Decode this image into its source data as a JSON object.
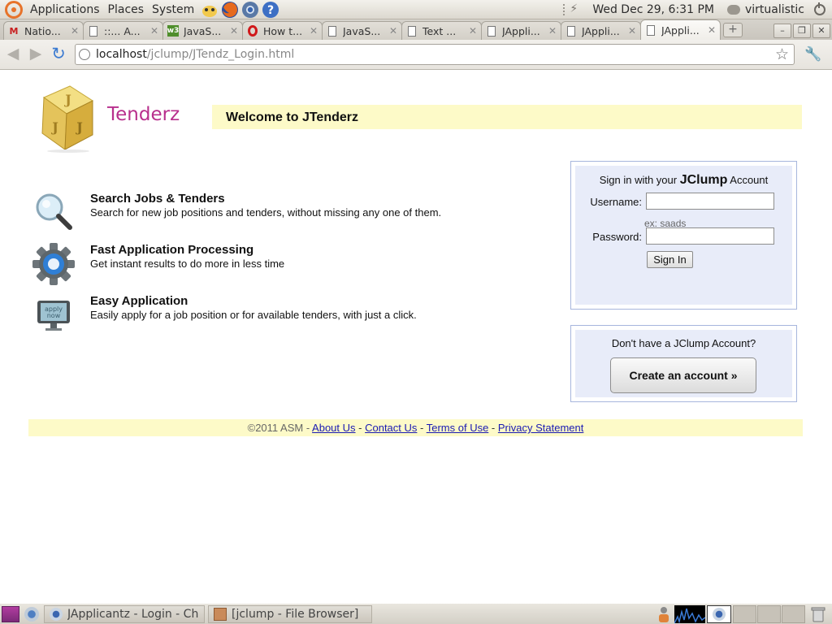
{
  "top_panel": {
    "menus": [
      "Applications",
      "Places",
      "System"
    ],
    "clock": "Wed Dec 29,  6:31 PM",
    "user": "virtualistic"
  },
  "tabs": [
    {
      "title": "Natio...",
      "favicon": "gmail-icon"
    },
    {
      "title": "::... A...",
      "favicon": "page-icon"
    },
    {
      "title": "JavaS...",
      "favicon": "w3schools-icon"
    },
    {
      "title": "How t...",
      "favicon": "opera-icon"
    },
    {
      "title": "JavaS...",
      "favicon": "page-icon"
    },
    {
      "title": "Text ...",
      "favicon": "page-icon"
    },
    {
      "title": "JAppli...",
      "favicon": "page-icon"
    },
    {
      "title": "JAppli...",
      "favicon": "page-icon"
    },
    {
      "title": "JAppli...",
      "favicon": "page-icon",
      "active": true
    }
  ],
  "toolbar": {
    "url_host": "localhost",
    "url_path": "/jclump/JTendz_Login.html"
  },
  "page": {
    "brand": "Tenderz",
    "welcome": "Welcome to JTenderz",
    "features": [
      {
        "title": "Search Jobs & Tenders",
        "desc": "Search for new job positions and tenders, without missing any one of them.",
        "icon": "magnifier-icon"
      },
      {
        "title": "Fast Application Processing",
        "desc": "Get instant results to do more in less time",
        "icon": "gear-icon"
      },
      {
        "title": "Easy Application",
        "desc": "Easily apply for a job position or for available tenders, with just a click.",
        "icon": "apply-now-monitor-icon"
      }
    ],
    "login": {
      "title_prefix": "Sign in with your ",
      "title_brand": "JClump",
      "title_suffix": " Account",
      "username_label": "Username:",
      "username_value": "",
      "username_hint": "ex: saads",
      "password_label": "Password:",
      "password_value": "",
      "signin_button": "Sign In"
    },
    "signup": {
      "question": "Don't have a JClump Account?",
      "button": "Create an account »"
    },
    "footer": {
      "copyright": "©2011 ASM - ",
      "links": [
        "About Us",
        "Contact Us",
        "Terms of Use",
        "Privacy Statement"
      ],
      "separator": " - "
    }
  },
  "bottom_panel": {
    "tasks": [
      {
        "label": "JApplicantz - Login - Ch...",
        "icon": "chrome-icon"
      },
      {
        "label": "[jclump - File Browser]",
        "icon": "folder-icon"
      }
    ]
  },
  "colors": {
    "brand": "#b82f8d",
    "highlight_bar": "#fdfac8",
    "login_panel": "#e8ecf9",
    "link": "#1a1ab3"
  }
}
